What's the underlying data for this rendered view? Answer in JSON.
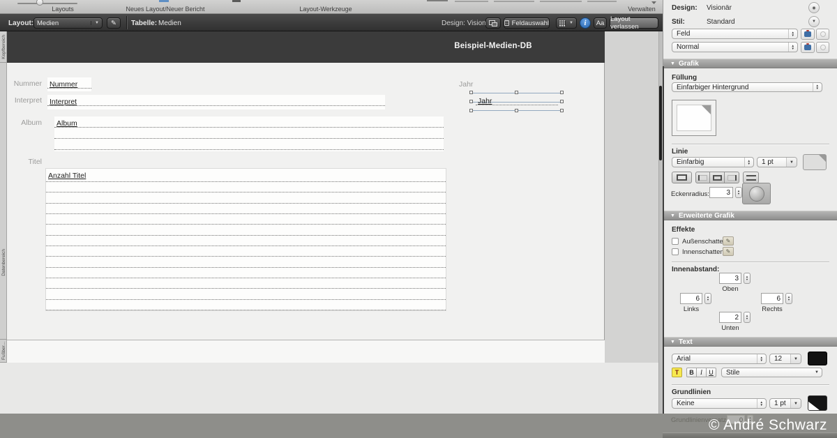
{
  "colors": {
    "accent_blue": "#2f6fb4",
    "selection_blue": "#93a9bf",
    "header_dark": "#3b3b3b",
    "watermark_band": "#8e8e8a",
    "highlight_yellow": "#f7e94f"
  },
  "toolbar_top": {
    "groups": [
      "Layouts",
      "Neues Layout/Neuer Bericht",
      "Layout-Werkzeuge",
      "Verwalten"
    ]
  },
  "layout_bar": {
    "layout_label": "Layout:",
    "layout_value": "Medien",
    "tabelle_label": "Tabelle:",
    "tabelle_value": "Medien",
    "design_info": "Design: Visionär",
    "feldauswahl_label": "Feldauswahl",
    "format_toggle_label": "Aa",
    "exit_label": "Layout verlassen",
    "pencil_icon": "✎"
  },
  "canvas": {
    "part_tabs": [
      "Kopfbereich",
      "Datenbereich",
      "Fußber..."
    ],
    "page_title": "Beispiel-Medien-DB",
    "fields": [
      {
        "label": "Nummer",
        "text": "Nummer"
      },
      {
        "label": "Interpret",
        "text": "Interpret"
      },
      {
        "label": "Album",
        "text": "Album"
      },
      {
        "label": "Titel",
        "text": "Anzahl Titel"
      },
      {
        "label": "Jahr",
        "text": "Jahr"
      }
    ]
  },
  "inspector": {
    "design_label": "Design:",
    "design_value": "Visionär",
    "stil_label": "Stil:",
    "stil_value": "Standard",
    "style_dropdown": "Feld",
    "state_dropdown": "Normal",
    "grafik": {
      "title": "Grafik",
      "fuellung_label": "Füllung",
      "fuellung_value": "Einfarbiger Hintergrund",
      "linie_label": "Linie",
      "linie_value": "Einfarbig",
      "linie_width": "1 pt",
      "eckenradius_label": "Eckenradius:",
      "eckenradius_value": "3"
    },
    "erweitert": {
      "title": "Erweiterte Grafik",
      "effekte_label": "Effekte",
      "aussenschatten": "Außenschatten",
      "innenschatten": "Innenschatten",
      "innenabstand_label": "Innenabstand:",
      "oben": {
        "value": "3",
        "label": "Oben"
      },
      "links": {
        "value": "6",
        "label": "Links"
      },
      "rechts": {
        "value": "6",
        "label": "Rechts"
      },
      "unten": {
        "value": "2",
        "label": "Unten"
      }
    },
    "text": {
      "title": "Text",
      "font": "Arial",
      "size": "12",
      "color_btn": "T",
      "bold": "B",
      "italic": "I",
      "underline": "U",
      "stile": "Stile",
      "grundlinien_label": "Grundlinien",
      "grundlinien_value": "Keine",
      "grundlinien_width": "1 pt",
      "versatz_label": "Grundlinienversatz:",
      "versatz_value": "0"
    }
  },
  "watermark": "© André Schwarz"
}
